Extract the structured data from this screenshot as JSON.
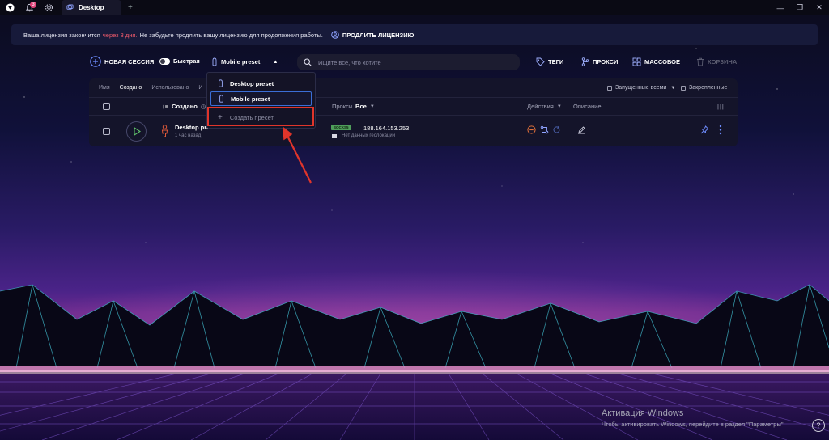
{
  "titlebar": {
    "notification_count": "3",
    "tab_label": "Desktop",
    "tab_add": "+",
    "controls": {
      "minimize": "—",
      "restore": "❐",
      "close": "✕"
    }
  },
  "banner": {
    "text_before": "Ваша лицензия закончится",
    "warning": "через 3 дня.",
    "text_after": "Не забудьте продлить вашу лицензию для продолжения работы.",
    "renew_label": "ПРОДЛИТЬ ЛИЦЕНЗИЮ",
    "warning_color": "#f15b6c"
  },
  "toolbar": {
    "new_session": "НОВАЯ СЕССИЯ",
    "quick": "Быстрая",
    "preset": "Mobile preset",
    "search_placeholder": "Ищите все, что хотите",
    "tags": "ТЕГИ",
    "proxies": "ПРОКСИ",
    "mass": "МАССОВОЕ",
    "trash": "КОРЗИНА"
  },
  "sort": {
    "items": [
      "Имя",
      "Создано",
      "Использовано",
      "И"
    ],
    "filter_running": "Запущенные всеми",
    "filter_pinned": "Закрепленные"
  },
  "table": {
    "headers": {
      "created": "Создано",
      "proxy": "Прокси",
      "proxy_all": "Все",
      "actions": "Действия",
      "description": "Описание",
      "columns": "|||"
    },
    "rows": [
      {
        "name": "Desktop preset 3",
        "time": "1 час назад",
        "proxy_type": "SOCKS5",
        "ip": "188.164.153.253",
        "geo": "Нет данных геолокации"
      }
    ]
  },
  "dropdown": {
    "items": [
      "Desktop preset",
      "Mobile preset"
    ],
    "create": "Создать пресет"
  },
  "watermark": {
    "title": "Активация Windows",
    "subtitle": "Чтобы активировать Windows, перейдите в раздел \"Параметры\"."
  },
  "help": "?",
  "colors": {
    "accent_blue": "#3b6ed6",
    "socks_green": "#4f9e5b",
    "highlight_red": "#e0352b",
    "stop_orange": "#e0703a",
    "person_red": "#e25a3a"
  }
}
